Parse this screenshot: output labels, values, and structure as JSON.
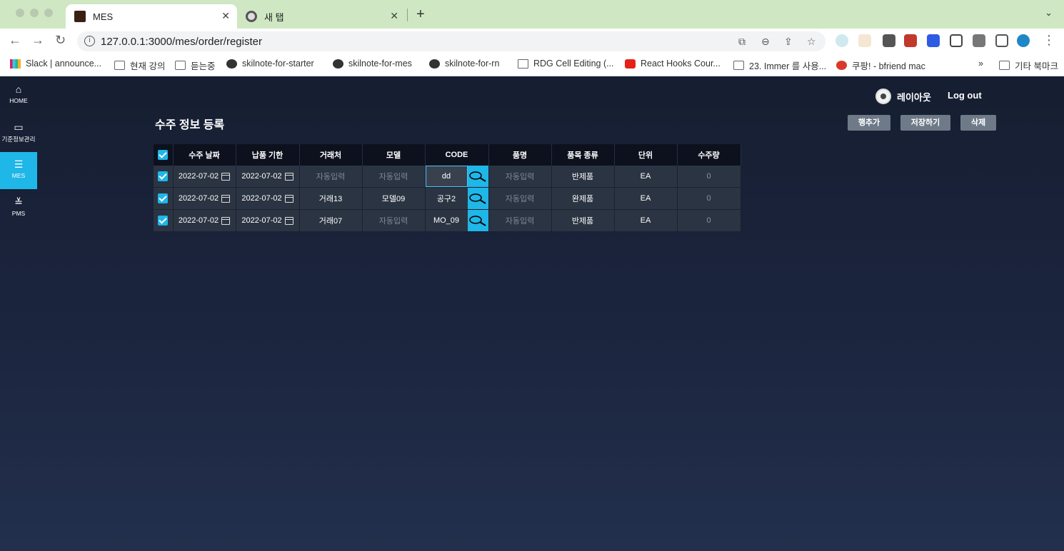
{
  "browser": {
    "tabs": [
      {
        "title": "MES"
      },
      {
        "title": "새 탭"
      }
    ],
    "url": "127.0.0.1:3000/mes/order/register",
    "bookmarks": [
      {
        "label": "Slack | announce..."
      },
      {
        "label": "현재 강의"
      },
      {
        "label": "듣는중"
      },
      {
        "label": "skilnote-for-starter"
      },
      {
        "label": "skilnote-for-mes"
      },
      {
        "label": "skilnote-for-rn"
      },
      {
        "label": "RDG Cell Editing (..."
      },
      {
        "label": "React Hooks Cour..."
      },
      {
        "label": "23. Immer 를 사용..."
      },
      {
        "label": "쿠팡! - bfriend mac"
      },
      {
        "label": "»"
      },
      {
        "label": "기타 북마크"
      }
    ]
  },
  "sidebar": {
    "items": [
      {
        "label": "HOME",
        "icon": "home-icon"
      },
      {
        "label": "기준정보관리",
        "icon": "folder-icon"
      },
      {
        "label": "MES",
        "icon": "sliders-icon"
      },
      {
        "label": "PMS",
        "icon": "press-icon"
      }
    ]
  },
  "header": {
    "username": "레이아웃",
    "logout": "Log out"
  },
  "page": {
    "title": "수주 정보 등록",
    "buttons": {
      "add_row": "행추가",
      "save": "저장하기",
      "delete": "삭제"
    }
  },
  "grid": {
    "columns": [
      "수주 날짜",
      "납품 기한",
      "거래처",
      "모델",
      "CODE",
      "품명",
      "품목 종류",
      "단위",
      "수주량"
    ],
    "rows": [
      {
        "checked": true,
        "order_date": "2022-07-02",
        "due_date": "2022-07-02",
        "customer": "자동입력",
        "model": "자동입력",
        "code": "dd",
        "name": "자동입력",
        "type": "반제품",
        "unit": "EA",
        "qty": "0"
      },
      {
        "checked": true,
        "order_date": "2022-07-02",
        "due_date": "2022-07-02",
        "customer": "거래13",
        "model": "모델09",
        "code": "공구2",
        "name": "자동입력",
        "type": "완제품",
        "unit": "EA",
        "qty": "0"
      },
      {
        "checked": true,
        "order_date": "2022-07-02",
        "due_date": "2022-07-02",
        "customer": "거래07",
        "model": "자동입력",
        "code": "MO_09",
        "name": "자동입력",
        "type": "반제품",
        "unit": "EA",
        "qty": "0"
      }
    ]
  },
  "colors": {
    "accent": "#1fb6e8",
    "header_bg": "#0c111d",
    "cell_bg": "#2b3442"
  }
}
